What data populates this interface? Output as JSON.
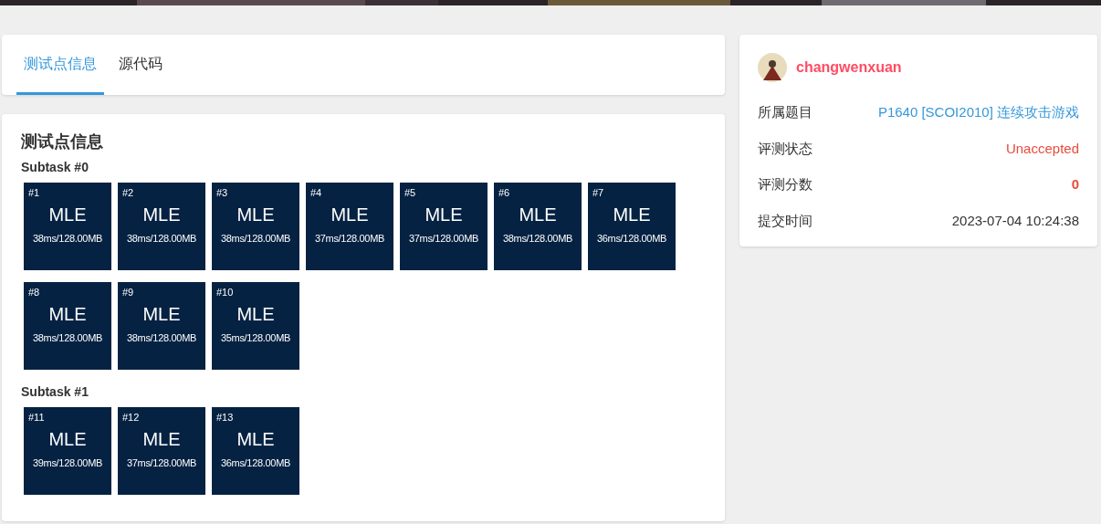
{
  "tabs": [
    {
      "label": "测试点信息",
      "selected": true
    },
    {
      "label": "源代码",
      "selected": false
    }
  ],
  "testcases": {
    "title": "测试点信息",
    "subtasks": [
      {
        "label": "Subtask #0",
        "cases": [
          {
            "id": "#1",
            "status": "MLE",
            "usage": "38ms/128.00MB"
          },
          {
            "id": "#2",
            "status": "MLE",
            "usage": "38ms/128.00MB"
          },
          {
            "id": "#3",
            "status": "MLE",
            "usage": "38ms/128.00MB"
          },
          {
            "id": "#4",
            "status": "MLE",
            "usage": "37ms/128.00MB"
          },
          {
            "id": "#5",
            "status": "MLE",
            "usage": "37ms/128.00MB"
          },
          {
            "id": "#6",
            "status": "MLE",
            "usage": "38ms/128.00MB"
          },
          {
            "id": "#7",
            "status": "MLE",
            "usage": "36ms/128.00MB"
          },
          {
            "id": "#8",
            "status": "MLE",
            "usage": "38ms/128.00MB"
          },
          {
            "id": "#9",
            "status": "MLE",
            "usage": "38ms/128.00MB"
          },
          {
            "id": "#10",
            "status": "MLE",
            "usage": "35ms/128.00MB"
          }
        ]
      },
      {
        "label": "Subtask #1",
        "cases": [
          {
            "id": "#11",
            "status": "MLE",
            "usage": "39ms/128.00MB"
          },
          {
            "id": "#12",
            "status": "MLE",
            "usage": "37ms/128.00MB"
          },
          {
            "id": "#13",
            "status": "MLE",
            "usage": "36ms/128.00MB"
          }
        ]
      }
    ]
  },
  "submission": {
    "user": "changwenxuan",
    "fields": [
      {
        "label": "所属题目",
        "value": "P1640 [SCOI2010] 连续攻击游戏",
        "kind": "link"
      },
      {
        "label": "评测状态",
        "value": "Unaccepted",
        "kind": "status"
      },
      {
        "label": "评测分数",
        "value": "0",
        "kind": "score"
      },
      {
        "label": "提交时间",
        "value": "2023-07-04 10:24:38",
        "kind": "plain"
      }
    ]
  }
}
